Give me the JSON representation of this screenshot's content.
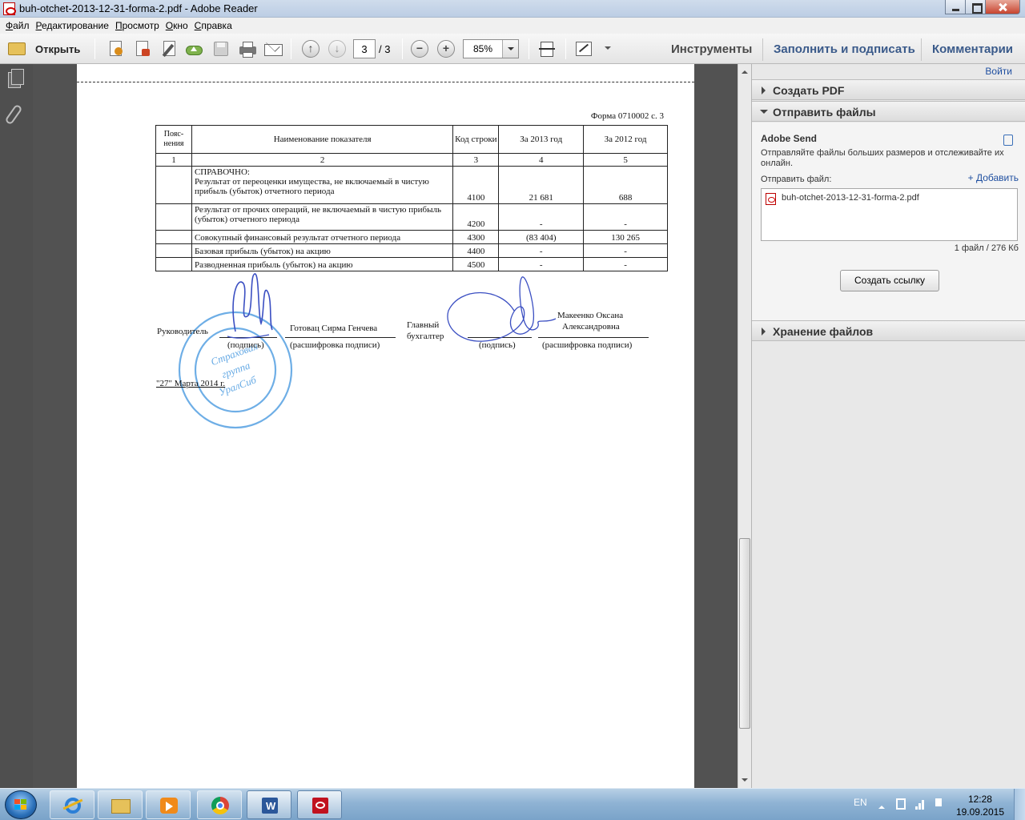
{
  "window": {
    "title": "buh-otchet-2013-12-31-forma-2.pdf - Adobe Reader"
  },
  "menu": {
    "items": [
      "Файл",
      "Редактирование",
      "Просмотр",
      "Окно",
      "Справка"
    ]
  },
  "toolbar": {
    "open_label": "Открыть",
    "page_current": "3",
    "page_total": "/ 3",
    "zoom": "85%",
    "panels": {
      "tools": "Инструменты",
      "fill_sign": "Заполнить и подписать",
      "comments": "Комментарии"
    }
  },
  "document": {
    "form_label": "Форма 0710002 с. 3",
    "table": {
      "headers": [
        "Пояс-нения",
        "Наименование показателя",
        "Код строки",
        "За 2013 год",
        "За 2012 год"
      ],
      "col_numbers": [
        "1",
        "2",
        "3",
        "4",
        "5"
      ],
      "rows": [
        {
          "note": "",
          "name_title": "СПРАВОЧНО:",
          "name": "Результат от переоценки имущества, не включаемый в чистую прибыль (убыток) отчетного периода",
          "code": "4100",
          "y2013": "21 681",
          "y2012": "688"
        },
        {
          "note": "",
          "name_title": "",
          "name": "Результат от прочих операций, не включаемый в чистую прибыль (убыток) отчетного периода",
          "code": "4200",
          "y2013": "-",
          "y2012": "-"
        },
        {
          "note": "",
          "name_title": "",
          "name": "Совокупный финансовый результат отчетного периода",
          "code": "4300",
          "y2013": "(83 404)",
          "y2012": "130 265"
        },
        {
          "note": "",
          "name_title": "",
          "name": "Базовая прибыль (убыток) на акцию",
          "code": "4400",
          "y2013": "-",
          "y2012": "-"
        },
        {
          "note": "",
          "name_title": "",
          "name": "Разводненная прибыль (убыток) на акцию",
          "code": "4500",
          "y2013": "-",
          "y2012": "-"
        }
      ]
    },
    "signatures": {
      "head_label": "Руководитель",
      "head_name": "Готовац Сирма Генчева",
      "signature_caption": "(подпись)",
      "decode_caption": "(расшифровка подписи)",
      "chief_accountant_label_1": "Главный",
      "chief_accountant_label_2": "бухгалтер",
      "accountant_name_1": "Макеенко Оксана",
      "accountant_name_2": "Александровна",
      "date": "\"27\" Марта 2014 г."
    },
    "stamp": {
      "line1": "Страховая",
      "line2": "группа",
      "line3": "УралСиб"
    }
  },
  "right_panel": {
    "login": "Войти",
    "create_pdf": "Создать PDF",
    "send_files": "Отправить файлы",
    "adobe_send": "Adobe Send",
    "send_description": "Отправляйте файлы больших размеров и отслеживайте их онлайн.",
    "send_file_label": "Отправить файл:",
    "add_link": "+ Добавить",
    "file_name": "buh-otchet-2013-12-31-forma-2.pdf",
    "file_summary": "1 файл / 276 Кб",
    "create_link_button": "Создать ссылку",
    "file_storage": "Хранение файлов"
  },
  "taskbar": {
    "language": "EN",
    "time": "12:28",
    "date": "19.09.2015"
  },
  "colors": {
    "link_blue": "#1f4fa0",
    "ink_blue": "#3b4fc2",
    "stamp_blue": "#4b9be0",
    "doc_background": "#525252"
  }
}
